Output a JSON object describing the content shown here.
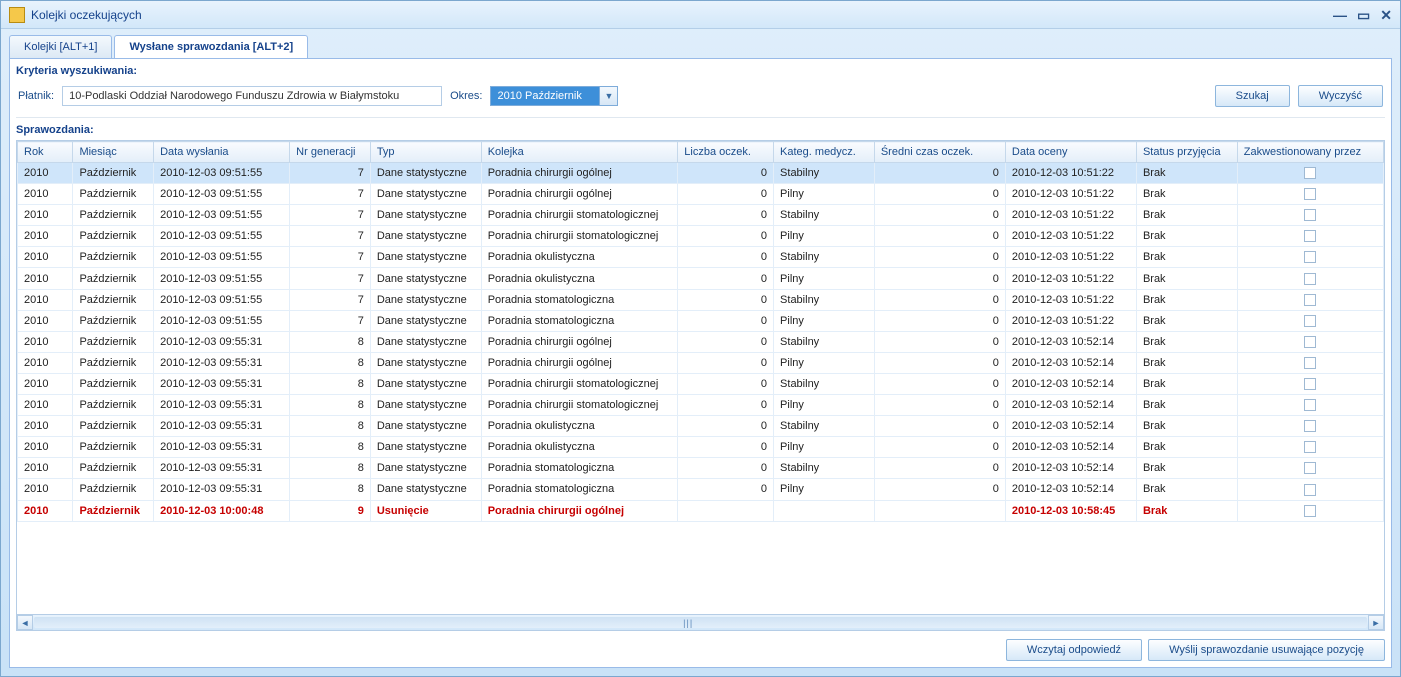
{
  "window": {
    "title": "Kolejki oczekujących"
  },
  "tabs": [
    {
      "label": "Kolejki [ALT+1]",
      "active": false
    },
    {
      "label": "Wysłane sprawozdania [ALT+2]",
      "active": true
    }
  ],
  "criteria": {
    "section_label": "Kryteria wyszukiwania:",
    "payer_label": "Płatnik:",
    "payer_value": "10-Podlaski Oddział Narodowego Funduszu Zdrowia w Białymstoku",
    "period_label": "Okres:",
    "period_value": "2010 Październik",
    "search_button": "Szukaj",
    "clear_button": "Wyczyść"
  },
  "reports": {
    "section_label": "Sprawozdania:",
    "columns": [
      "Rok",
      "Miesiąc",
      "Data wysłania",
      "Nr generacji",
      "Typ",
      "Kolejka",
      "Liczba oczek.",
      "Kateg. medycz.",
      "Średni czas oczek.",
      "Data oceny",
      "Status przyjęcia",
      "Zakwestionowany przez"
    ],
    "rows": [
      {
        "selected": true,
        "red": false,
        "rok": "2010",
        "miesiac": "Październik",
        "data_wys": "2010-12-03 09:51:55",
        "nr_gen": "7",
        "typ": "Dane statystyczne",
        "kolejka": "Poradnia chirurgii ogólnej",
        "liczba": "0",
        "kateg": "Stabilny",
        "sredni": "0",
        "data_oceny": "2010-12-03 10:51:22",
        "status": "Brak",
        "zakw": false
      },
      {
        "selected": false,
        "red": false,
        "rok": "2010",
        "miesiac": "Październik",
        "data_wys": "2010-12-03 09:51:55",
        "nr_gen": "7",
        "typ": "Dane statystyczne",
        "kolejka": "Poradnia chirurgii ogólnej",
        "liczba": "0",
        "kateg": "Pilny",
        "sredni": "0",
        "data_oceny": "2010-12-03 10:51:22",
        "status": "Brak",
        "zakw": false
      },
      {
        "selected": false,
        "red": false,
        "rok": "2010",
        "miesiac": "Październik",
        "data_wys": "2010-12-03 09:51:55",
        "nr_gen": "7",
        "typ": "Dane statystyczne",
        "kolejka": "Poradnia chirurgii stomatologicznej",
        "liczba": "0",
        "kateg": "Stabilny",
        "sredni": "0",
        "data_oceny": "2010-12-03 10:51:22",
        "status": "Brak",
        "zakw": false
      },
      {
        "selected": false,
        "red": false,
        "rok": "2010",
        "miesiac": "Październik",
        "data_wys": "2010-12-03 09:51:55",
        "nr_gen": "7",
        "typ": "Dane statystyczne",
        "kolejka": "Poradnia chirurgii stomatologicznej",
        "liczba": "0",
        "kateg": "Pilny",
        "sredni": "0",
        "data_oceny": "2010-12-03 10:51:22",
        "status": "Brak",
        "zakw": false
      },
      {
        "selected": false,
        "red": false,
        "rok": "2010",
        "miesiac": "Październik",
        "data_wys": "2010-12-03 09:51:55",
        "nr_gen": "7",
        "typ": "Dane statystyczne",
        "kolejka": "Poradnia okulistyczna",
        "liczba": "0",
        "kateg": "Stabilny",
        "sredni": "0",
        "data_oceny": "2010-12-03 10:51:22",
        "status": "Brak",
        "zakw": false
      },
      {
        "selected": false,
        "red": false,
        "rok": "2010",
        "miesiac": "Październik",
        "data_wys": "2010-12-03 09:51:55",
        "nr_gen": "7",
        "typ": "Dane statystyczne",
        "kolejka": "Poradnia okulistyczna",
        "liczba": "0",
        "kateg": "Pilny",
        "sredni": "0",
        "data_oceny": "2010-12-03 10:51:22",
        "status": "Brak",
        "zakw": false
      },
      {
        "selected": false,
        "red": false,
        "rok": "2010",
        "miesiac": "Październik",
        "data_wys": "2010-12-03 09:51:55",
        "nr_gen": "7",
        "typ": "Dane statystyczne",
        "kolejka": "Poradnia stomatologiczna",
        "liczba": "0",
        "kateg": "Stabilny",
        "sredni": "0",
        "data_oceny": "2010-12-03 10:51:22",
        "status": "Brak",
        "zakw": false
      },
      {
        "selected": false,
        "red": false,
        "rok": "2010",
        "miesiac": "Październik",
        "data_wys": "2010-12-03 09:51:55",
        "nr_gen": "7",
        "typ": "Dane statystyczne",
        "kolejka": "Poradnia stomatologiczna",
        "liczba": "0",
        "kateg": "Pilny",
        "sredni": "0",
        "data_oceny": "2010-12-03 10:51:22",
        "status": "Brak",
        "zakw": false
      },
      {
        "selected": false,
        "red": false,
        "rok": "2010",
        "miesiac": "Październik",
        "data_wys": "2010-12-03 09:55:31",
        "nr_gen": "8",
        "typ": "Dane statystyczne",
        "kolejka": "Poradnia chirurgii ogólnej",
        "liczba": "0",
        "kateg": "Stabilny",
        "sredni": "0",
        "data_oceny": "2010-12-03 10:52:14",
        "status": "Brak",
        "zakw": false
      },
      {
        "selected": false,
        "red": false,
        "rok": "2010",
        "miesiac": "Październik",
        "data_wys": "2010-12-03 09:55:31",
        "nr_gen": "8",
        "typ": "Dane statystyczne",
        "kolejka": "Poradnia chirurgii ogólnej",
        "liczba": "0",
        "kateg": "Pilny",
        "sredni": "0",
        "data_oceny": "2010-12-03 10:52:14",
        "status": "Brak",
        "zakw": false
      },
      {
        "selected": false,
        "red": false,
        "rok": "2010",
        "miesiac": "Październik",
        "data_wys": "2010-12-03 09:55:31",
        "nr_gen": "8",
        "typ": "Dane statystyczne",
        "kolejka": "Poradnia chirurgii stomatologicznej",
        "liczba": "0",
        "kateg": "Stabilny",
        "sredni": "0",
        "data_oceny": "2010-12-03 10:52:14",
        "status": "Brak",
        "zakw": false
      },
      {
        "selected": false,
        "red": false,
        "rok": "2010",
        "miesiac": "Październik",
        "data_wys": "2010-12-03 09:55:31",
        "nr_gen": "8",
        "typ": "Dane statystyczne",
        "kolejka": "Poradnia chirurgii stomatologicznej",
        "liczba": "0",
        "kateg": "Pilny",
        "sredni": "0",
        "data_oceny": "2010-12-03 10:52:14",
        "status": "Brak",
        "zakw": false
      },
      {
        "selected": false,
        "red": false,
        "rok": "2010",
        "miesiac": "Październik",
        "data_wys": "2010-12-03 09:55:31",
        "nr_gen": "8",
        "typ": "Dane statystyczne",
        "kolejka": "Poradnia okulistyczna",
        "liczba": "0",
        "kateg": "Stabilny",
        "sredni": "0",
        "data_oceny": "2010-12-03 10:52:14",
        "status": "Brak",
        "zakw": false
      },
      {
        "selected": false,
        "red": false,
        "rok": "2010",
        "miesiac": "Październik",
        "data_wys": "2010-12-03 09:55:31",
        "nr_gen": "8",
        "typ": "Dane statystyczne",
        "kolejka": "Poradnia okulistyczna",
        "liczba": "0",
        "kateg": "Pilny",
        "sredni": "0",
        "data_oceny": "2010-12-03 10:52:14",
        "status": "Brak",
        "zakw": false
      },
      {
        "selected": false,
        "red": false,
        "rok": "2010",
        "miesiac": "Październik",
        "data_wys": "2010-12-03 09:55:31",
        "nr_gen": "8",
        "typ": "Dane statystyczne",
        "kolejka": "Poradnia stomatologiczna",
        "liczba": "0",
        "kateg": "Stabilny",
        "sredni": "0",
        "data_oceny": "2010-12-03 10:52:14",
        "status": "Brak",
        "zakw": false
      },
      {
        "selected": false,
        "red": false,
        "rok": "2010",
        "miesiac": "Październik",
        "data_wys": "2010-12-03 09:55:31",
        "nr_gen": "8",
        "typ": "Dane statystyczne",
        "kolejka": "Poradnia stomatologiczna",
        "liczba": "0",
        "kateg": "Pilny",
        "sredni": "0",
        "data_oceny": "2010-12-03 10:52:14",
        "status": "Brak",
        "zakw": false
      },
      {
        "selected": false,
        "red": true,
        "rok": "2010",
        "miesiac": "Październik",
        "data_wys": "2010-12-03 10:00:48",
        "nr_gen": "9",
        "typ": "Usunięcie",
        "kolejka": "Poradnia chirurgii ogólnej",
        "liczba": "",
        "kateg": "",
        "sredni": "",
        "data_oceny": "2010-12-03 10:58:45",
        "status": "Brak",
        "zakw": false
      }
    ]
  },
  "footer": {
    "load_response_button": "Wczytaj odpowiedź",
    "send_delete_report_button": "Wyślij sprawozdanie usuwające pozycję"
  }
}
